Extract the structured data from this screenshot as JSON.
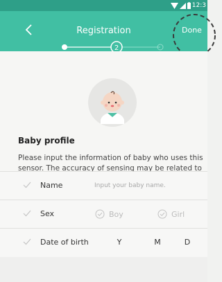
{
  "status_bar": {
    "time": "12:3",
    "icons": [
      "wifi-icon",
      "signal-icon",
      "battery-icon"
    ]
  },
  "header": {
    "title": "Registration",
    "done_label": "Done",
    "back_icon": "chevron-left-icon",
    "background": "#41bfa3"
  },
  "stepper": {
    "current_step": "2",
    "total_steps": 3,
    "accent": "#ffffff"
  },
  "profile": {
    "avatar_icon": "baby-avatar-icon",
    "heading": "Baby profile",
    "description": "Please input the information of baby who uses this sensor. The accuracy of sensing may be related to this information."
  },
  "form": {
    "name": {
      "label": "Name",
      "placeholder": "Input your baby name."
    },
    "sex": {
      "label": "Sex",
      "options": [
        "Boy",
        "Girl"
      ]
    },
    "birth": {
      "label": "Date of birth",
      "year": "Y",
      "month": "M",
      "day": "D"
    }
  }
}
